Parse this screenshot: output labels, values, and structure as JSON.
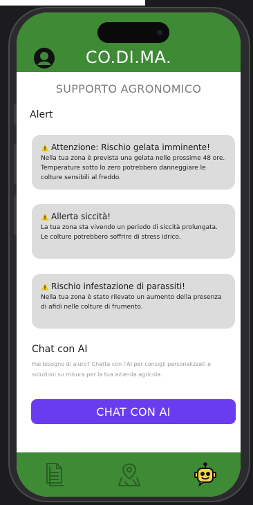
{
  "header": {
    "title": "CO.DI.MA.",
    "avatar_icon": "user-avatar-icon"
  },
  "subtitle": "SUPPORTO AGRONOMICO",
  "alerts_section": {
    "title": "Alert",
    "items": [
      {
        "icon": "warning-icon",
        "title": "Attenzione: Rischio gelata imminente!",
        "body": "Nella tua zona è prevista una gelata nelle prossime 48 ore. Temperature sotto lo zero potrebbero danneggiare le colture sensibili al freddo."
      },
      {
        "icon": "warning-icon",
        "title": "Allerta siccità!",
        "body": "La tua zona sta vivendo un periodo di siccità prolungata. Le colture potrebbero soffrire di stress idrico."
      },
      {
        "icon": "warning-icon",
        "title": "Rischio infestazione di parassiti!",
        "body": "Nella tua zona è stato rilevato un aumento della presenza di afidi nelle colture di frumento."
      }
    ]
  },
  "chat": {
    "title": "Chat con AI",
    "description": "Hai bisogno di aiuto? Chatta con l'AI per consigli personalizzati e soluzioni su misura per la tua azienda agricola.",
    "button_label": "CHAT CON AI"
  },
  "bottom_nav": {
    "items": [
      {
        "icon": "documents-icon",
        "active": false
      },
      {
        "icon": "map-pin-icon",
        "active": false
      },
      {
        "icon": "robot-chat-icon",
        "active": true
      }
    ]
  },
  "colors": {
    "header_green": "#3e8a35",
    "card_grey": "#dcdcdc",
    "chat_button_purple": "#6a3cf0",
    "warning_yellow": "#f5c518"
  }
}
